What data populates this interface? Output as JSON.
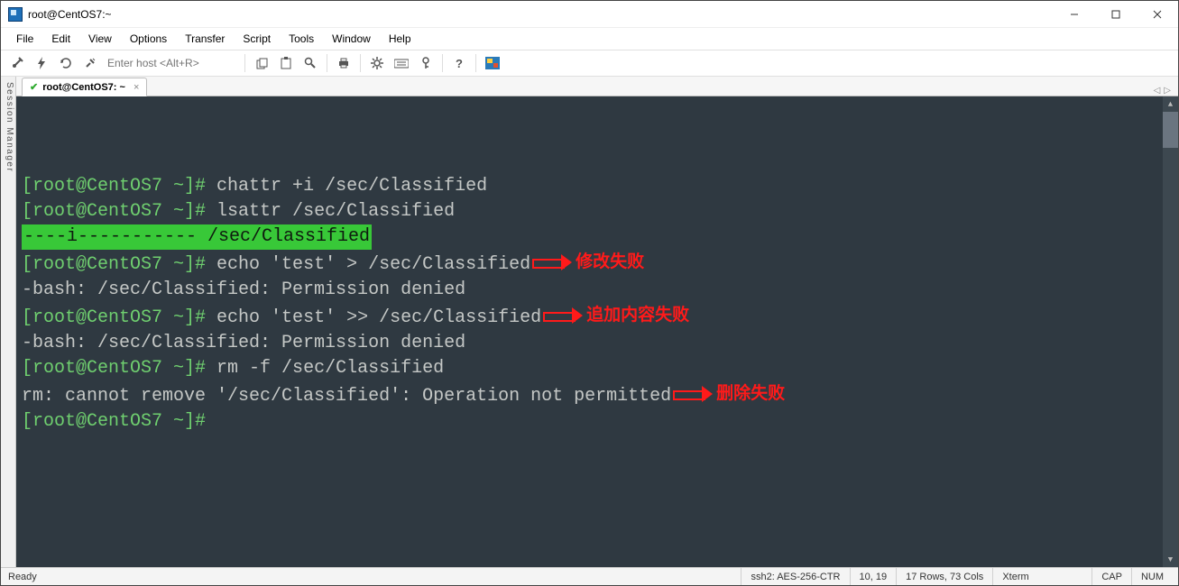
{
  "window": {
    "title": "root@CentOS7:~"
  },
  "menu": {
    "items": [
      "File",
      "Edit",
      "View",
      "Options",
      "Transfer",
      "Script",
      "Tools",
      "Window",
      "Help"
    ]
  },
  "toolbar": {
    "host_placeholder": "Enter host <Alt+R>"
  },
  "sidepanel": {
    "label": "Session Manager"
  },
  "tabs": {
    "items": [
      {
        "label": "root@CentOS7: ~",
        "connected": true
      }
    ]
  },
  "terminal": {
    "prompt": "[root@CentOS7 ~]# ",
    "lines": [
      {
        "type": "cmd",
        "text": "chattr +i /sec/Classified"
      },
      {
        "type": "cmd",
        "text": "lsattr /sec/Classified"
      },
      {
        "type": "hl",
        "text": "----i----------- /sec/Classified"
      },
      {
        "type": "cmd",
        "text": "echo 'test' > /sec/Classified",
        "annot": "修改失败"
      },
      {
        "type": "out",
        "text": "-bash: /sec/Classified: Permission denied"
      },
      {
        "type": "cmd",
        "text": "echo 'test' >> /sec/Classified",
        "annot": "追加内容失败"
      },
      {
        "type": "out",
        "text": "-bash: /sec/Classified: Permission denied"
      },
      {
        "type": "cmd",
        "text": "rm -f /sec/Classified"
      },
      {
        "type": "out",
        "text": "rm: cannot remove '/sec/Classified': Operation not permitted",
        "annot": "删除失败"
      },
      {
        "type": "cmd",
        "text": ""
      }
    ]
  },
  "status": {
    "ready": "Ready",
    "conn": "ssh2: AES-256-CTR",
    "pos": "10,  19",
    "size": "17 Rows, 73 Cols",
    "emu": "Xterm",
    "caps": "CAP",
    "num": "NUM"
  }
}
